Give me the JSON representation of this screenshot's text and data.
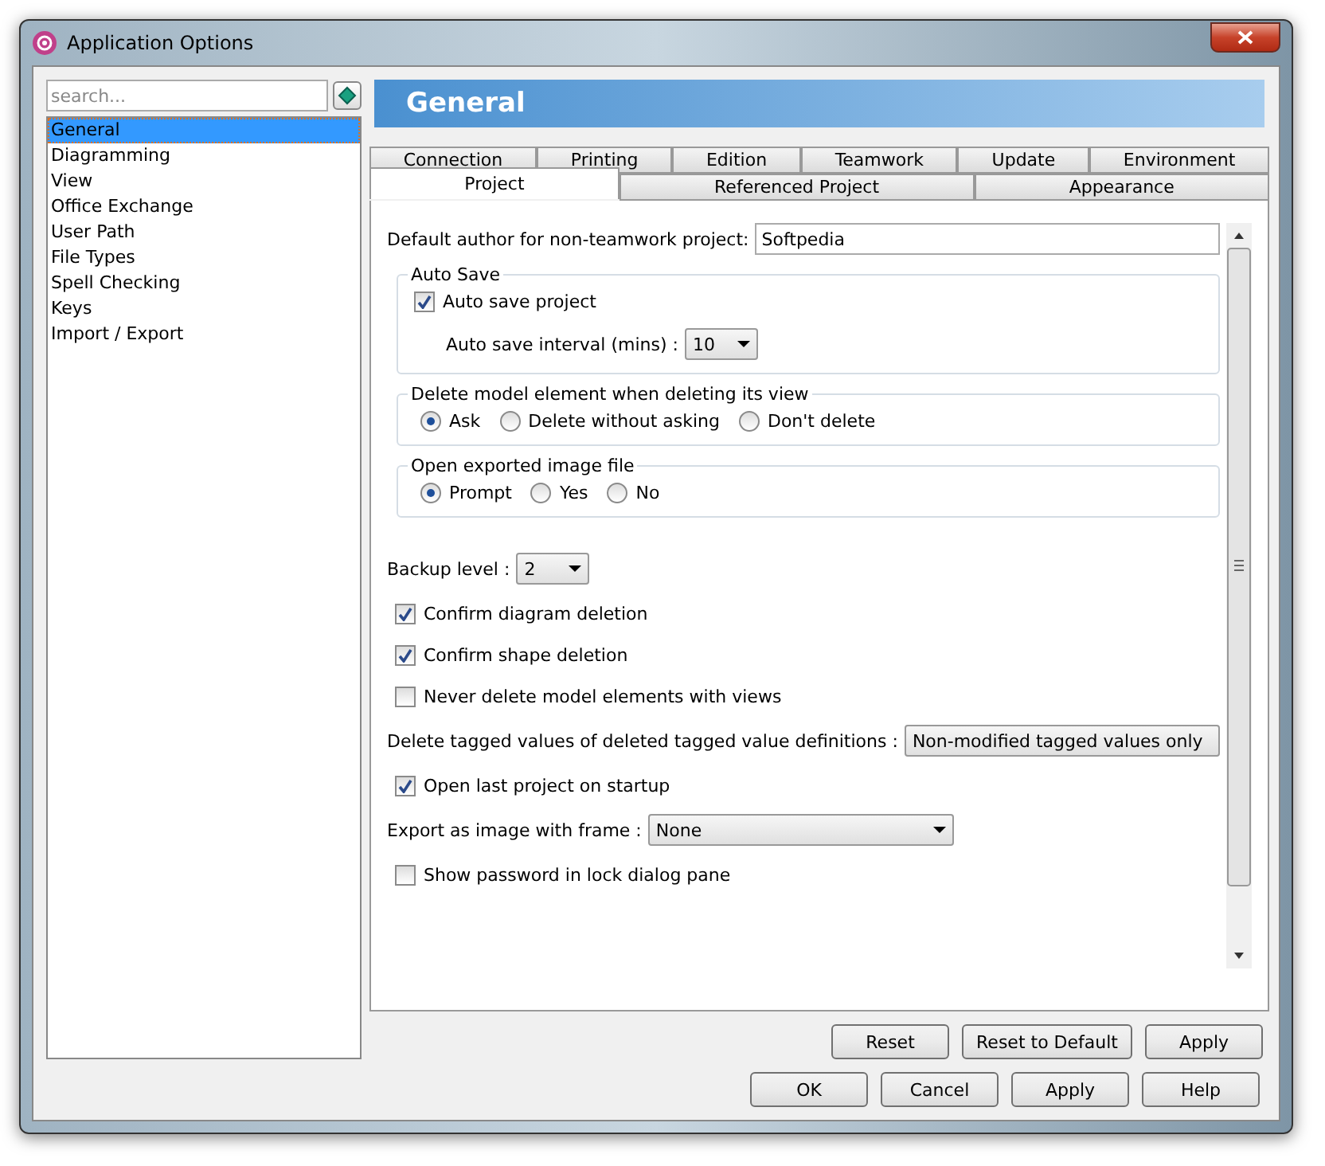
{
  "window": {
    "title": "Application Options"
  },
  "sidebar": {
    "search": {
      "placeholder": "search..."
    },
    "items": [
      {
        "label": "General",
        "selected": true
      },
      {
        "label": "Diagramming",
        "selected": false
      },
      {
        "label": "View",
        "selected": false
      },
      {
        "label": "Office Exchange",
        "selected": false
      },
      {
        "label": "User Path",
        "selected": false
      },
      {
        "label": "File Types",
        "selected": false
      },
      {
        "label": "Spell Checking",
        "selected": false
      },
      {
        "label": "Keys",
        "selected": false
      },
      {
        "label": "Import / Export",
        "selected": false
      }
    ]
  },
  "header": {
    "title": "General"
  },
  "tabs": {
    "back_row": [
      {
        "label": "Connection",
        "selected": false
      },
      {
        "label": "Printing",
        "selected": false
      },
      {
        "label": "Edition",
        "selected": false
      },
      {
        "label": "Teamwork",
        "selected": false
      },
      {
        "label": "Update",
        "selected": false
      },
      {
        "label": "Environment",
        "selected": false
      }
    ],
    "front_row": [
      {
        "label": "Project",
        "selected": true
      },
      {
        "label": "Referenced Project",
        "selected": false
      },
      {
        "label": "Appearance",
        "selected": false
      }
    ]
  },
  "default_author": {
    "label": "Default author for non-teamwork project:",
    "value": "Softpedia"
  },
  "auto_save": {
    "title": "Auto Save",
    "checkbox": {
      "label": "Auto save project",
      "checked": true
    },
    "interval": {
      "label": "Auto save interval (mins) :",
      "value": "10"
    }
  },
  "radio_groups": [
    {
      "title": "Delete model element when deleting its view",
      "options": [
        {
          "label": "Ask",
          "selected": true
        },
        {
          "label": "Delete without asking",
          "selected": false
        },
        {
          "label": "Don't delete",
          "selected": false
        }
      ]
    },
    {
      "title": "Open exported image file",
      "options": [
        {
          "label": "Prompt",
          "selected": true
        },
        {
          "label": "Yes",
          "selected": false
        },
        {
          "label": "No",
          "selected": false
        }
      ]
    }
  ],
  "settings": [
    {
      "kind": "dropdown",
      "label": "Backup level :",
      "value": "2"
    },
    {
      "kind": "checkbox",
      "label": "Confirm diagram deletion",
      "checked": true
    },
    {
      "kind": "checkbox",
      "label": "Confirm shape deletion",
      "checked": true
    },
    {
      "kind": "checkbox",
      "label": "Never delete model elements with views",
      "checked": false
    },
    {
      "kind": "dropdown",
      "label": "Delete tagged values of deleted tagged value definitions :",
      "value": "Non-modified tagged values only"
    },
    {
      "kind": "checkbox",
      "label": "Open last project on startup",
      "checked": true
    },
    {
      "kind": "dropdown",
      "label": "Export as image with frame :",
      "value": "None"
    },
    {
      "kind": "checkbox",
      "label": "Show password in lock dialog pane",
      "checked": false
    }
  ],
  "panel_buttons": [
    "Reset",
    "Reset to Default",
    "Apply"
  ],
  "dialog_buttons": [
    "OK",
    "Cancel",
    "Apply",
    "Help"
  ]
}
